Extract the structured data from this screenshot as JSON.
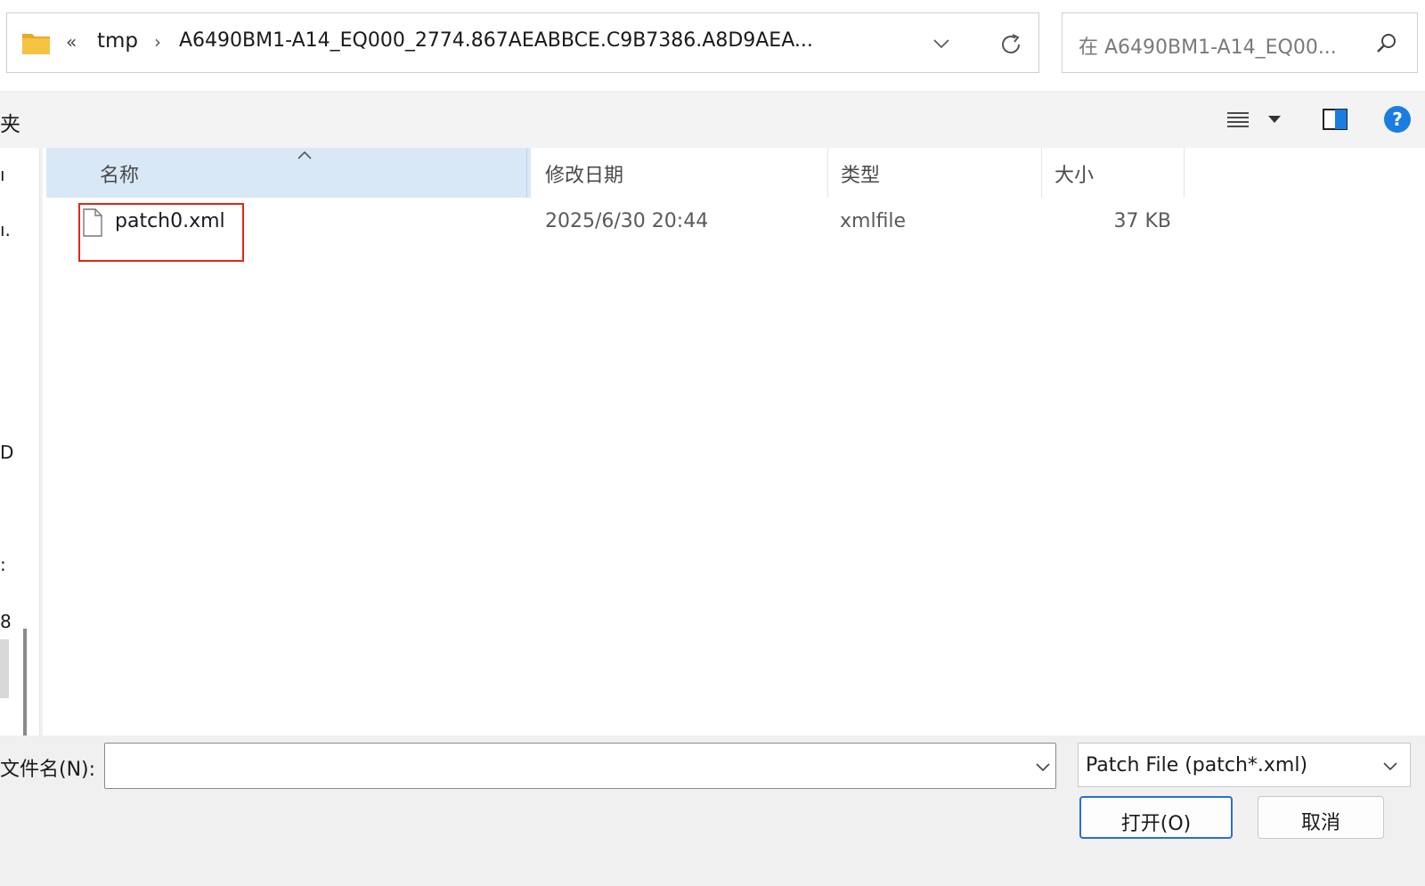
{
  "address_bar": {
    "overflow": "«",
    "crumbs": [
      "tmp",
      "A6490BM1-A14_EQ000_2774.867AEABBCE.C9B7386.A8D9AEA..."
    ],
    "separator": "›"
  },
  "search": {
    "placeholder": "在 A6490BM1-A14_EQ00..."
  },
  "toolbar": {
    "left_fragment": "夹"
  },
  "nav_pane": {
    "fragments": [
      "ı",
      "ı.",
      "D",
      ":",
      "8"
    ]
  },
  "columns": {
    "name": "名称",
    "date": "修改日期",
    "type": "类型",
    "size": "大小"
  },
  "files": [
    {
      "name": "patch0.xml",
      "modified": "2025/6/30 20:44",
      "type": "xmlfile",
      "size": "37 KB"
    }
  ],
  "bottom": {
    "filename_label": "文件名(N):",
    "filename_value": "",
    "filter": "Patch File (patch*.xml)",
    "open_label": "打开(O)",
    "cancel_label": "取消"
  },
  "colors": {
    "accent": "#2a6fc9",
    "highlight": "#e0261a",
    "help": "#1a7de0",
    "folder": "#f5c242"
  },
  "icons": [
    "folder-icon",
    "chevron-down-icon",
    "refresh-icon",
    "search-icon",
    "list-view-icon",
    "preview-pane-icon",
    "help-icon",
    "file-icon",
    "sort-ascending-icon"
  ]
}
